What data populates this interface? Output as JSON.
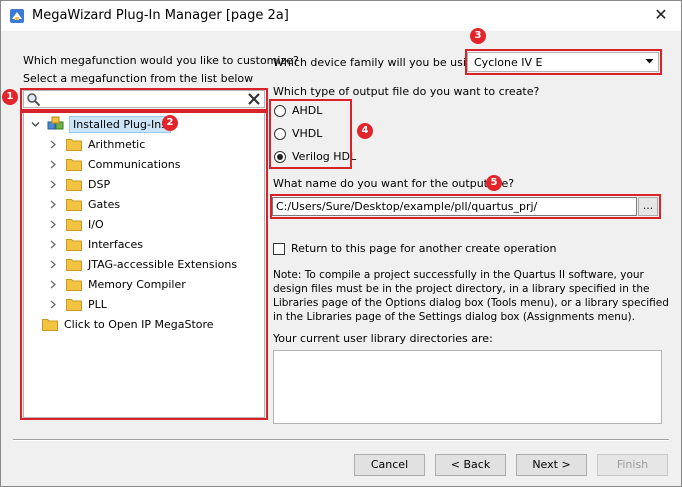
{
  "window": {
    "title": "MegaWizard Plug-In Manager [page 2a]",
    "close_glyph": "✕"
  },
  "left": {
    "question": "Which megafunction would you like to customize?",
    "instruction": "Select a megafunction from the list below",
    "search": {
      "value": "",
      "placeholder": ""
    },
    "tree": {
      "root_label": "Installed Plug-Ins",
      "items": [
        {
          "label": "Arithmetic"
        },
        {
          "label": "Communications"
        },
        {
          "label": "DSP"
        },
        {
          "label": "Gates"
        },
        {
          "label": "I/O"
        },
        {
          "label": "Interfaces"
        },
        {
          "label": "JTAG-accessible Extensions"
        },
        {
          "label": "Memory Compiler"
        },
        {
          "label": "PLL"
        }
      ],
      "megastore_label": "Click to Open IP MegaStore"
    }
  },
  "right": {
    "device_question": "Which device family will you be using?",
    "device_value": "Cyclone IV E",
    "output_type_question": "Which type of output file do you want to create?",
    "output_types": [
      {
        "label": "AHDL",
        "checked": false
      },
      {
        "label": "VHDL",
        "checked": false
      },
      {
        "label": "Verilog HDL",
        "checked": true
      }
    ],
    "output_name_question": "What name do you want for the output file?",
    "output_path": "C:/Users/Sure/Desktop/example/pll/quartus_prj/",
    "browse_label": "...",
    "return_checkbox_label": "Return to this page for another create operation",
    "note": "Note: To compile a project successfully in the Quartus II software, your design files must be in the project directory, in a library specified in the Libraries page of the Options dialog box (Tools menu), or a library specified in the Libraries page of the Settings dialog box (Assignments menu).",
    "libdirs_label": "Your current user library directories are:"
  },
  "buttons": {
    "cancel": "Cancel",
    "back": "< Back",
    "next": "Next >",
    "finish": "Finish"
  },
  "callouts": [
    "1",
    "2",
    "3",
    "4",
    "5"
  ],
  "colors": {
    "callout_red": "#e2242b",
    "highlight_box": "#d9232b",
    "folder_yellow": "#f5c342",
    "selection_blue": "#cce4f7"
  }
}
